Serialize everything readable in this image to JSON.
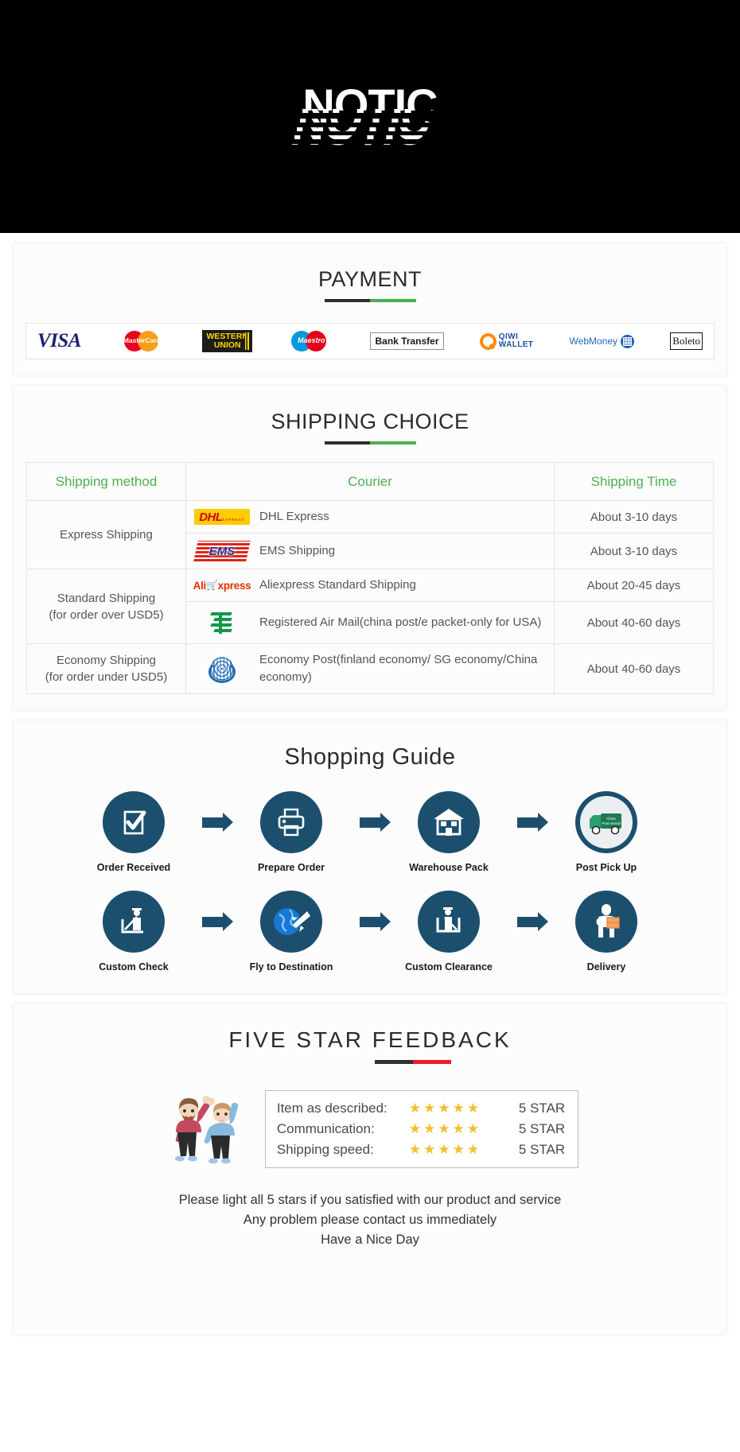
{
  "banner": {
    "title": "NOTIC"
  },
  "payment": {
    "heading": "PAYMENT",
    "methods": [
      {
        "name": "visa-logo",
        "label": "VISA"
      },
      {
        "name": "mastercard-logo",
        "label": "MasterCard"
      },
      {
        "name": "western-union-logo",
        "label_top": "WESTERN",
        "label_bottom": "UNION"
      },
      {
        "name": "maestro-logo",
        "label": "Maestro"
      },
      {
        "name": "bank-transfer-logo",
        "label": "Bank Transfer"
      },
      {
        "name": "qiwi-wallet-logo",
        "label_top": "QIWI",
        "label_bottom": "WALLET"
      },
      {
        "name": "webmoney-logo",
        "label": "WebMoney"
      },
      {
        "name": "boleto-logo",
        "label": "Boleto"
      }
    ]
  },
  "shipping": {
    "heading": "SHIPPING CHOICE",
    "columns": [
      "Shipping method",
      "Courier",
      "Shipping Time"
    ],
    "rows": [
      {
        "method": "Express Shipping",
        "method_span": 2,
        "courier_logo": "dhl-logo",
        "courier": "DHL Express",
        "time": "About 3-10 days"
      },
      {
        "courier_logo": "ems-logo",
        "courier": "EMS Shipping",
        "time": "About 3-10 days"
      },
      {
        "method": "Standard Shipping\n(for order over USD5)",
        "method_line1": "Standard Shipping",
        "method_line2": "(for order over USD5)",
        "method_span": 2,
        "courier_logo": "aliexpress-logo",
        "courier": "Aliexpress Standard Shipping",
        "time": "About 20-45 days"
      },
      {
        "courier_logo": "china-post-logo",
        "courier": "Registered Air Mail(china post/e packet-only for USA)",
        "time": "About 40-60 days"
      },
      {
        "method_line1": "Economy Shipping",
        "method_line2": "(for order under USD5)",
        "method_span": 1,
        "courier_logo": "united-nations-logo",
        "courier": "Economy Post(finland economy/ SG economy/China economy)",
        "time": "About 40-60 days"
      }
    ]
  },
  "guide": {
    "heading": "Shopping Guide",
    "steps_row1": [
      {
        "icon": "checklist-icon",
        "label": "Order Received"
      },
      {
        "icon": "printer-icon",
        "label": "Prepare Order"
      },
      {
        "icon": "warehouse-house-icon",
        "label": "Warehouse Pack"
      },
      {
        "icon": "post-truck-icon",
        "label": "Post Pick Up"
      }
    ],
    "steps_row2": [
      {
        "icon": "customs-officer-scan-icon",
        "label": "Custom Check"
      },
      {
        "icon": "globe-airplane-icon",
        "label": "Fly to Destination"
      },
      {
        "icon": "customs-clearance-icon",
        "label": "Custom Clearance"
      },
      {
        "icon": "delivery-person-icon",
        "label": "Delivery"
      }
    ]
  },
  "feedback": {
    "heading": "FIVE  STAR  FEEDBACK",
    "ratings": [
      {
        "label": "Item as described:",
        "stars": "★★★★★",
        "value": "5 STAR"
      },
      {
        "label": "Communication:",
        "stars": "★★★★★",
        "value": "5 STAR"
      },
      {
        "label": "Shipping speed:",
        "stars": "★★★★★",
        "value": "5 STAR"
      }
    ],
    "notes": [
      "Please light all 5 stars if you satisfied with our product and service",
      "Any problem please contact us immediately",
      "Have a Nice Day"
    ]
  },
  "colors": {
    "banner_bg": "#000000",
    "accent_green": "#4caf50",
    "accent_red": "#ee1b24",
    "rule_dark": "#303030",
    "guide_navy": "#1c4f6e",
    "star_gold": "#f5bf2b"
  }
}
